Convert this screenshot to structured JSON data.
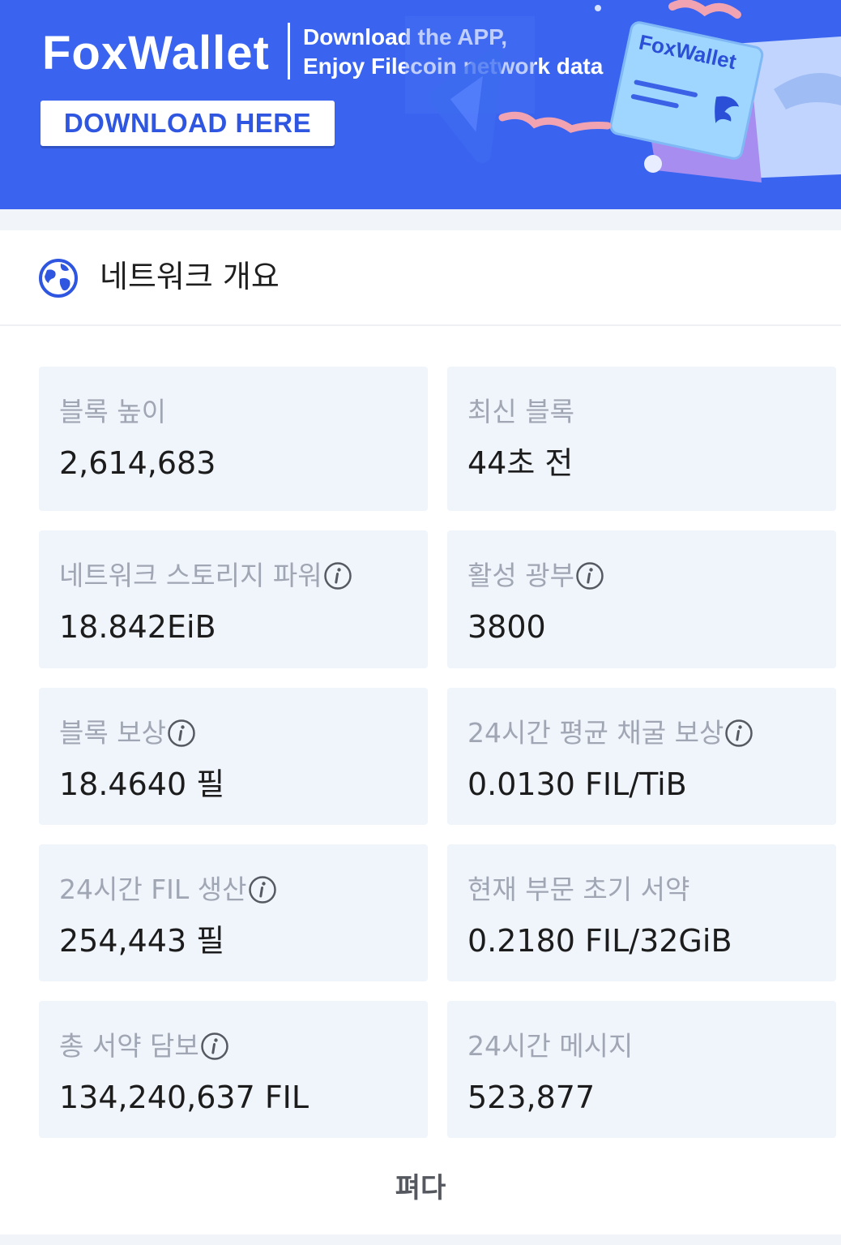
{
  "banner": {
    "brand": "FoxWallet",
    "tagline_line1": "Download the APP,",
    "tagline_line2": "Enjoy Filecoin network data",
    "button_label": "DOWNLOAD HERE",
    "card_logo": "FoxWallet"
  },
  "section": {
    "title": "네트워크 개요",
    "icon": "globe-icon"
  },
  "stats": [
    {
      "label": "블록 높이",
      "value": "2,614,683",
      "has_info": false
    },
    {
      "label": "최신 블록",
      "value": "44초 전",
      "has_info": false
    },
    {
      "label": "네트워크 스토리지 파워",
      "value": "18.842EiB",
      "has_info": true
    },
    {
      "label": "활성 광부",
      "value": "3800",
      "has_info": true
    },
    {
      "label": "블록 보상",
      "value": "18.4640 필",
      "has_info": true
    },
    {
      "label": "24시간 평균 채굴 보상",
      "value": "0.0130 FIL/TiB",
      "has_info": true
    },
    {
      "label": "24시간 FIL 생산",
      "value": "254,443 필",
      "has_info": true
    },
    {
      "label": "현재 부문 초기 서약",
      "value": "0.2180 FIL/32GiB",
      "has_info": false
    },
    {
      "label": "총 서약 담보",
      "value": "134,240,637 FIL",
      "has_info": true
    },
    {
      "label": "24시간 메시지",
      "value": "523,877",
      "has_info": false
    }
  ],
  "expand_label": "펴다",
  "colors": {
    "banner_bg": "#3a64ef",
    "card_bg": "#f0f4fb",
    "label_text": "#a0a6b3",
    "value_text": "#1c1c1c",
    "accent": "#2f56e0"
  }
}
